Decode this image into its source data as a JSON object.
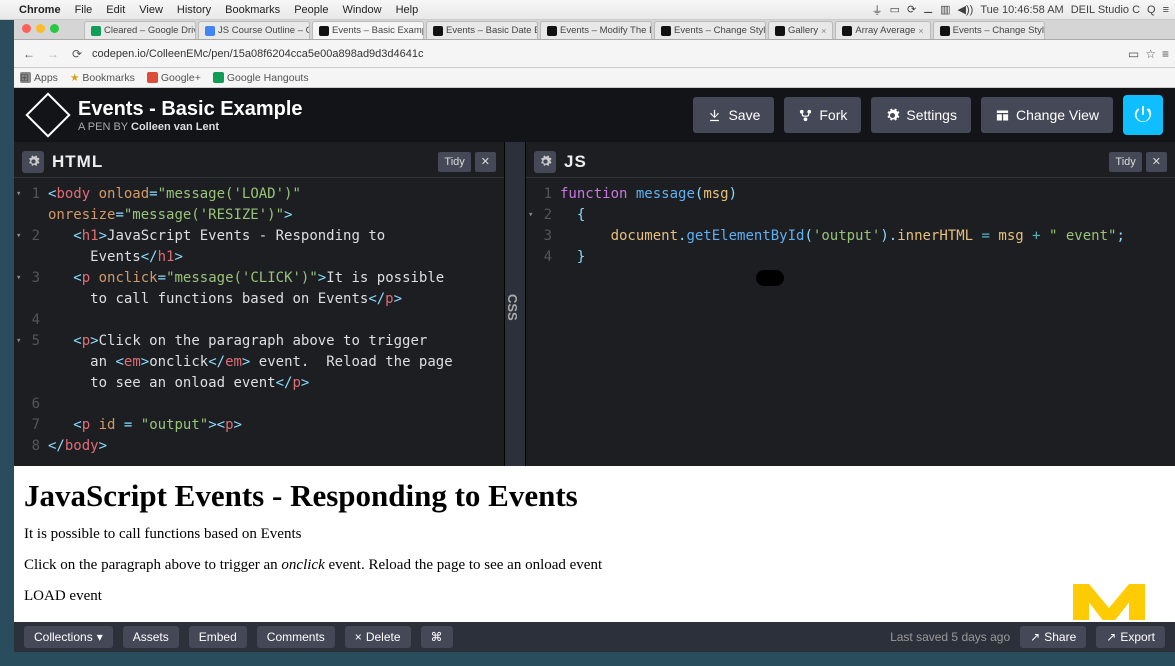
{
  "mac_menu": {
    "app": "Chrome",
    "items": [
      "File",
      "Edit",
      "View",
      "History",
      "Bookmarks",
      "People",
      "Window",
      "Help"
    ],
    "clock": "Tue 10:46:58 AM",
    "studio": "DEIL Studio C"
  },
  "browser": {
    "tabs": [
      "Cleared – Google Drive",
      "JS Course Outline – Goo…",
      "Events – Basic Example",
      "Events – Basic Date Exa…",
      "Events – Modify The DO…",
      "Events – Change Style",
      "Gallery",
      "Array Average",
      "Events – Change Style"
    ],
    "active_tab": 2,
    "url": "codepen.io/ColleenEMc/pen/15a08f6204cca5e00a898ad9d3d4641c",
    "bookmarks": [
      "Apps",
      "Bookmarks",
      "Google+",
      "Google Hangouts"
    ]
  },
  "codepen": {
    "title": "Events - Basic Example",
    "subtitle_prefix": "A PEN BY ",
    "author": "Colleen van Lent",
    "buttons": {
      "save": "Save",
      "fork": "Fork",
      "settings": "Settings",
      "change_view": "Change View"
    },
    "panes": {
      "html": {
        "title": "HTML",
        "tidy": "Tidy"
      },
      "css": {
        "title": "CSS"
      },
      "js": {
        "title": "JS",
        "tidy": "Tidy"
      }
    },
    "footer": {
      "collections": "Collections",
      "assets": "Assets",
      "embed": "Embed",
      "comments": "Comments",
      "delete": "Delete",
      "saved": "Last saved 5 days ago",
      "share": "Share",
      "export": "Export"
    }
  },
  "html_code": {
    "l1": "<body onload=\"message('LOAD')\"",
    "l1b": "onresize=\"message('RESIZE')\">",
    "l2": "<h1>JavaScript Events - Responding to",
    "l2b": "Events</h1>",
    "l3": "<p onclick=\"message('CLICK')\">It is possible",
    "l3b": "to call functions based on Events</p>",
    "l5": "<p>Click on the paragraph above to trigger",
    "l5b": "an <em>onclick</em> event.  Reload the page",
    "l5c": "to see an onload event</p>",
    "l7": "<p id = \"output\"><p>",
    "l8": "</body>"
  },
  "js_code": {
    "l1": "function message(msg)",
    "l2": "{",
    "l3": "document.getElementById('output').innerHTML = msg + \" event\";",
    "l4": "}"
  },
  "output": {
    "h1": "JavaScript Events - Responding to Events",
    "p1": "It is possible to call functions based on Events",
    "p2a": "Click on the paragraph above to trigger an ",
    "p2em": "onclick",
    "p2b": " event. Reload the page to see an onload event",
    "p3": "LOAD event"
  }
}
